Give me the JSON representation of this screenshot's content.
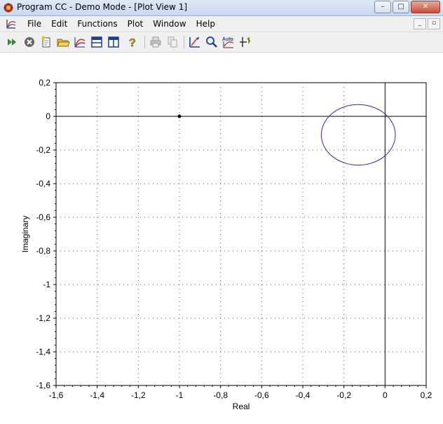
{
  "window": {
    "title": "Program CC - Demo Mode - [Plot View 1]",
    "controls": {
      "minimize": "–",
      "maximize": "□",
      "close": "✕"
    }
  },
  "menubar": {
    "items": [
      "File",
      "Edit",
      "Functions",
      "Plot",
      "Window",
      "Help"
    ],
    "mdi_controls": [
      "_",
      "▫"
    ]
  },
  "toolbar": {
    "buttons": [
      {
        "icon": "run-icon",
        "color": "#2e8b2e"
      },
      {
        "icon": "stop-icon",
        "color": "#555555"
      },
      {
        "icon": "new-document-icon",
        "color": "#c9a227"
      },
      {
        "icon": "open-folder-icon",
        "color": "#d8a824"
      },
      {
        "icon": "plot-lines-icon",
        "color": "#6a1b9a"
      },
      {
        "icon": "split-horizontal-icon",
        "color": "#1f3f8a"
      },
      {
        "icon": "split-vertical-icon",
        "color": "#1f3f8a"
      },
      {
        "icon": "help-icon",
        "color": "#c9a227"
      },
      {
        "icon": "print-icon",
        "color": "#9a9a9a"
      },
      {
        "icon": "copy-icon",
        "color": "#9a9a9a"
      },
      {
        "icon": "plot-settings-icon",
        "color": "#1f3f8a"
      },
      {
        "icon": "zoom-icon",
        "color": "#1f3f8a"
      },
      {
        "icon": "auto-scale-icon",
        "label": "Auto",
        "color": "#1f3f8a"
      },
      {
        "icon": "crosshair-icon",
        "color": "#6b6b00"
      }
    ]
  },
  "chart_data": {
    "type": "line",
    "title": "",
    "xlabel": "Real",
    "ylabel": "Imaginary",
    "xlim": [
      -1.6,
      0.2
    ],
    "ylim": [
      -1.6,
      0.2
    ],
    "x_ticks": [
      "-1,6",
      "-1,4",
      "-1,2",
      "-1",
      "-0,8",
      "-0,6",
      "-0,4",
      "-0,2",
      "0",
      "0,2"
    ],
    "y_ticks": [
      "0,2",
      "0",
      "-0,2",
      "-0,4",
      "-0,6",
      "-0,8",
      "-1",
      "-1,2",
      "-1,4",
      "-1,6"
    ],
    "x_tick_values": [
      -1.6,
      -1.4,
      -1.2,
      -1.0,
      -0.8,
      -0.6,
      -0.4,
      -0.2,
      0,
      0.2
    ],
    "y_tick_values": [
      0.2,
      0,
      -0.2,
      -0.4,
      -0.6,
      -0.8,
      -1.0,
      -1.2,
      -1.4,
      -1.6
    ],
    "grid": true,
    "critical_point": {
      "x": -1,
      "y": 0
    },
    "series": [
      {
        "color": "#2a2ab8",
        "shape": "closed_curve",
        "center": {
          "x": -0.13,
          "y": -0.11
        },
        "radius_x": 0.18,
        "radius_y": 0.18
      }
    ]
  }
}
